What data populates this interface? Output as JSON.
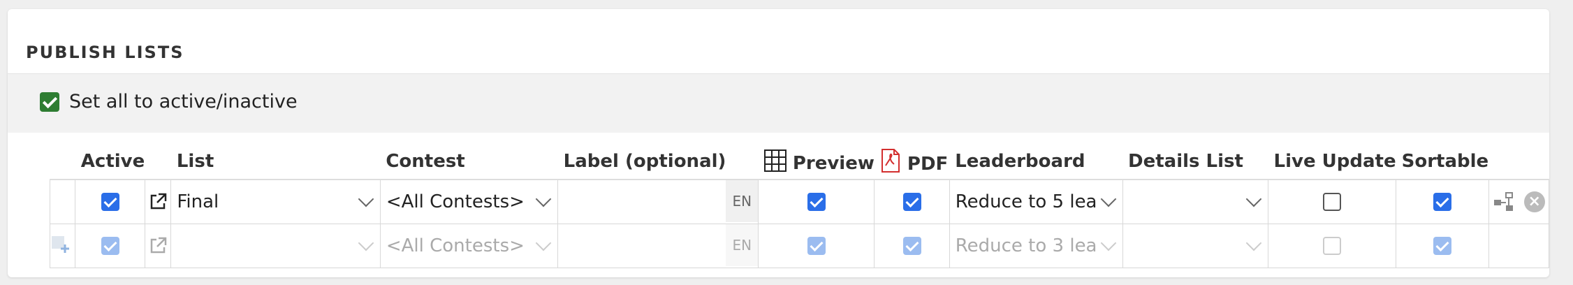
{
  "panel": {
    "title": "PUBLISH LISTS"
  },
  "toolbar": {
    "set_all_label": "Set all to active/inactive",
    "set_all_checked": true
  },
  "columns": {
    "active": "Active",
    "list": "List",
    "contest": "Contest",
    "label": "Label (optional)",
    "preview": "Preview",
    "pdf": "PDF",
    "leaderboard": "Leaderboard",
    "details": "Details List",
    "live_update": "Live Update",
    "sortable": "Sortable"
  },
  "rows": [
    {
      "active": true,
      "list": "Final",
      "contest": "<All Contests>",
      "label": "",
      "lang": "EN",
      "preview": true,
      "pdf": true,
      "leaderboard": "Reduce to 5 lea",
      "details": "",
      "live_update": false,
      "sortable": true
    },
    {
      "active": true,
      "list": "",
      "contest": "<All Contests>",
      "label": "",
      "lang": "EN",
      "preview": true,
      "pdf": true,
      "leaderboard": "Reduce to 3 lea",
      "details": "",
      "live_update": false,
      "sortable": true
    }
  ],
  "colors": {
    "active_checkbox": "#2a6ee8",
    "set_all_checkbox": "#2e7d32",
    "pdf_icon": "#d32f2f"
  },
  "icons": [
    "external-link-icon",
    "table-grid-icon",
    "pdf-icon",
    "flow-diagram-icon",
    "remove-icon",
    "add-row-icon",
    "chevron-down-icon"
  ]
}
